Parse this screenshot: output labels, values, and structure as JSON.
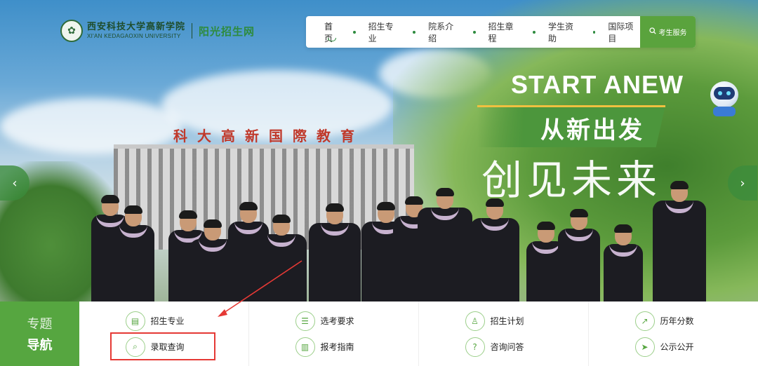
{
  "logo": {
    "seal": "✿",
    "name_cn": "西安科技大学高新学院",
    "name_en": "XI'AN KEDAGAOXIN UNIVERSITY",
    "site_name": "阳光招生网"
  },
  "nav": {
    "items": [
      {
        "label": "首页",
        "active": true
      },
      {
        "label": "招生专业"
      },
      {
        "label": "院系介绍"
      },
      {
        "label": "招生章程"
      },
      {
        "label": "学生资助"
      },
      {
        "label": "国际项目"
      }
    ],
    "service_label": "考生服务",
    "service_icon": "search-icon"
  },
  "hero": {
    "building_sign": "科大高新国際教育",
    "slogan_en": "START ANEW",
    "slogan_cn1": "从新出发",
    "slogan_cn2": "创见未来",
    "prev": "‹",
    "next": "›"
  },
  "quick_nav": {
    "title_line1": "专题",
    "title_line2": "导航",
    "columns": [
      [
        {
          "label": "招生专业",
          "icon": "book-icon",
          "glyph": "▤"
        },
        {
          "label": "录取查询",
          "icon": "search-doc-icon",
          "glyph": "⌕"
        }
      ],
      [
        {
          "label": "选考要求",
          "icon": "list-icon",
          "glyph": "☰"
        },
        {
          "label": "报考指南",
          "icon": "guide-book-icon",
          "glyph": "▥"
        }
      ],
      [
        {
          "label": "招生计划",
          "icon": "user-plan-icon",
          "glyph": "♙"
        },
        {
          "label": "咨询问答",
          "icon": "qa-icon",
          "glyph": "?"
        }
      ],
      [
        {
          "label": "历年分数",
          "icon": "line-chart-icon",
          "glyph": "↗"
        },
        {
          "label": "公示公开",
          "icon": "send-icon",
          "glyph": "➤"
        }
      ]
    ]
  },
  "colors": {
    "brand_green": "#56a640",
    "annotation_red": "#e53935"
  }
}
